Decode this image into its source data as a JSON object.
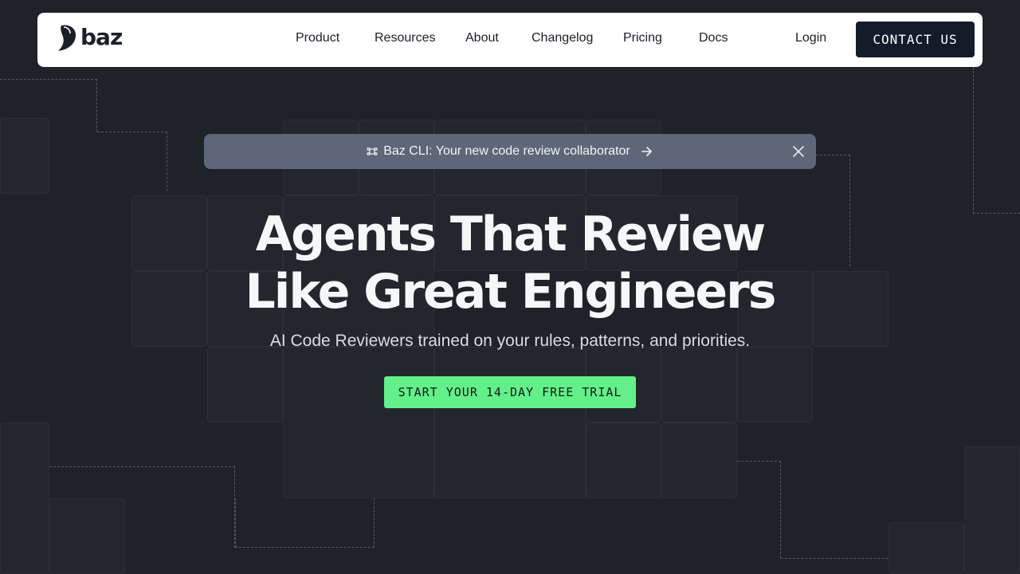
{
  "nav": {
    "logo_text": "baz",
    "items": [
      {
        "label": "Product"
      },
      {
        "label": "Resources"
      },
      {
        "label": "About"
      },
      {
        "label": "Changelog"
      },
      {
        "label": "Pricing"
      },
      {
        "label": "Docs"
      }
    ],
    "login_label": "Login",
    "contact_label": "CONTACT US"
  },
  "banner": {
    "text": "Baz CLI: Your new code review collaborator",
    "icon": "command-key-icon",
    "arrow_icon": "arrow-right-icon",
    "close_icon": "close-icon"
  },
  "hero": {
    "title_line1": "Agents That Review",
    "title_line2": "Like Great Engineers",
    "subtitle": "AI Code Reviewers trained on your rules, patterns, and priorities.",
    "cta_label": "START YOUR 14-DAY FREE TRIAL"
  },
  "colors": {
    "background": "#1f2228",
    "nav_background": "#ffffff",
    "contact_button": "#131c29",
    "banner": "#5d6777",
    "cta": "#63f08a"
  }
}
